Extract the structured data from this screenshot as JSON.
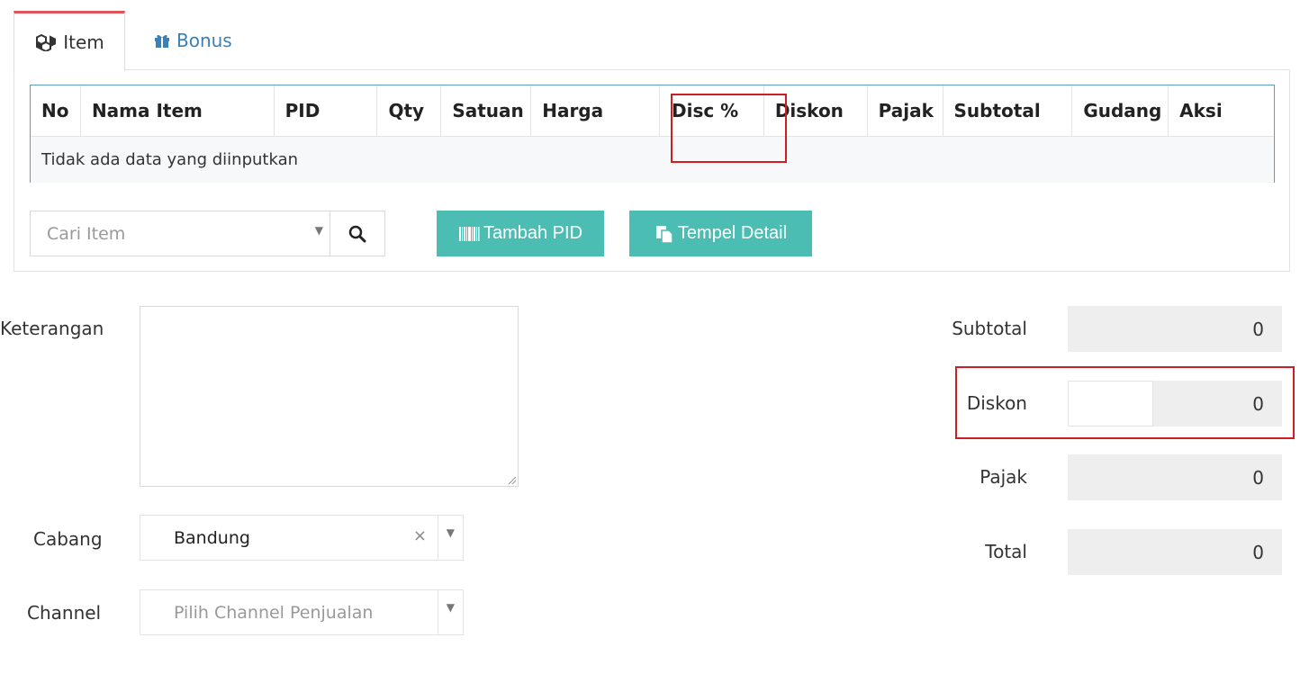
{
  "tabs": [
    {
      "label": "Item",
      "icon": "cubes-icon",
      "active": true
    },
    {
      "label": "Bonus",
      "icon": "gift-icon",
      "active": false
    }
  ],
  "table": {
    "columns": [
      "No",
      "Nama Item",
      "PID",
      "Qty",
      "Satuan",
      "Harga",
      "Disc %",
      "Diskon",
      "Pajak",
      "Subtotal",
      "Gudang",
      "Aksi"
    ],
    "empty_message": "Tidak ada data yang diinputkan"
  },
  "search": {
    "placeholder": "Cari Item",
    "icon": "search-icon"
  },
  "buttons": {
    "tambah_pid": "Tambah PID",
    "tempel_detail": "Tempel Detail"
  },
  "form": {
    "keterangan_label": "Keterangan",
    "cabang_label": "Cabang",
    "cabang_value": "Bandung",
    "channel_label": "Channel",
    "channel_placeholder": "Pilih Channel Penjualan"
  },
  "totals": {
    "subtotal_label": "Subtotal",
    "subtotal_value": "0",
    "diskon_label": "Diskon",
    "diskon_value": "0",
    "pajak_label": "Pajak",
    "pajak_value": "0",
    "total_label": "Total",
    "total_value": "0"
  },
  "colors": {
    "accent_teal": "#4cbdb2",
    "tab_active_border": "#e0545a",
    "highlight_red": "#d01d24",
    "link_blue": "#3a7fb5"
  }
}
